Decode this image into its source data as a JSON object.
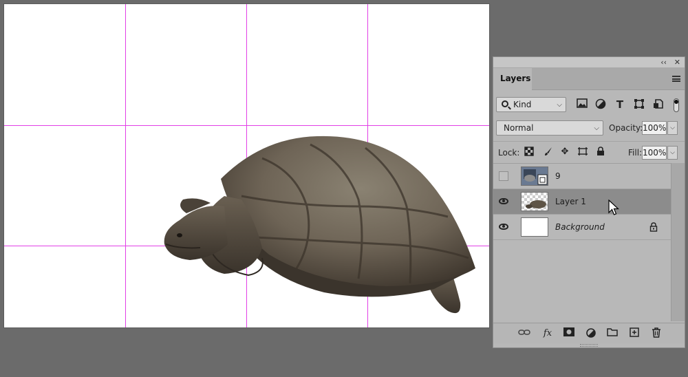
{
  "panel": {
    "collapse_glyph": "‹‹",
    "close_glyph": "✕",
    "tab_label": "Layers",
    "filter": {
      "kind_label": "Kind",
      "icons": [
        "image-filter-icon",
        "adjustment-filter-icon",
        "type-filter-icon",
        "shape-filter-icon",
        "smart-object-filter-icon"
      ]
    },
    "blend_mode": "Normal",
    "opacity_label": "Opacity:",
    "opacity_value": "100%",
    "lock_label": "Lock:",
    "fill_label": "Fill:",
    "fill_value": "100%",
    "layers": [
      {
        "name": "9",
        "visible": false,
        "type": "smart-object",
        "selected": false
      },
      {
        "name": "Layer 1",
        "visible": true,
        "type": "pixel",
        "selected": true
      },
      {
        "name": "Background",
        "visible": true,
        "type": "background",
        "selected": false,
        "locked": true
      }
    ],
    "bottom_icons": [
      "link-layers-icon",
      "fx-icon",
      "add-mask-icon",
      "adjustment-layer-icon",
      "new-group-icon",
      "new-layer-icon",
      "delete-layer-icon"
    ]
  },
  "colors": {
    "guide": "#e23ee6",
    "workspace": "#6b6b6b",
    "panel_bg": "#b8b8b8",
    "selected_row": "#8c8c8c"
  }
}
